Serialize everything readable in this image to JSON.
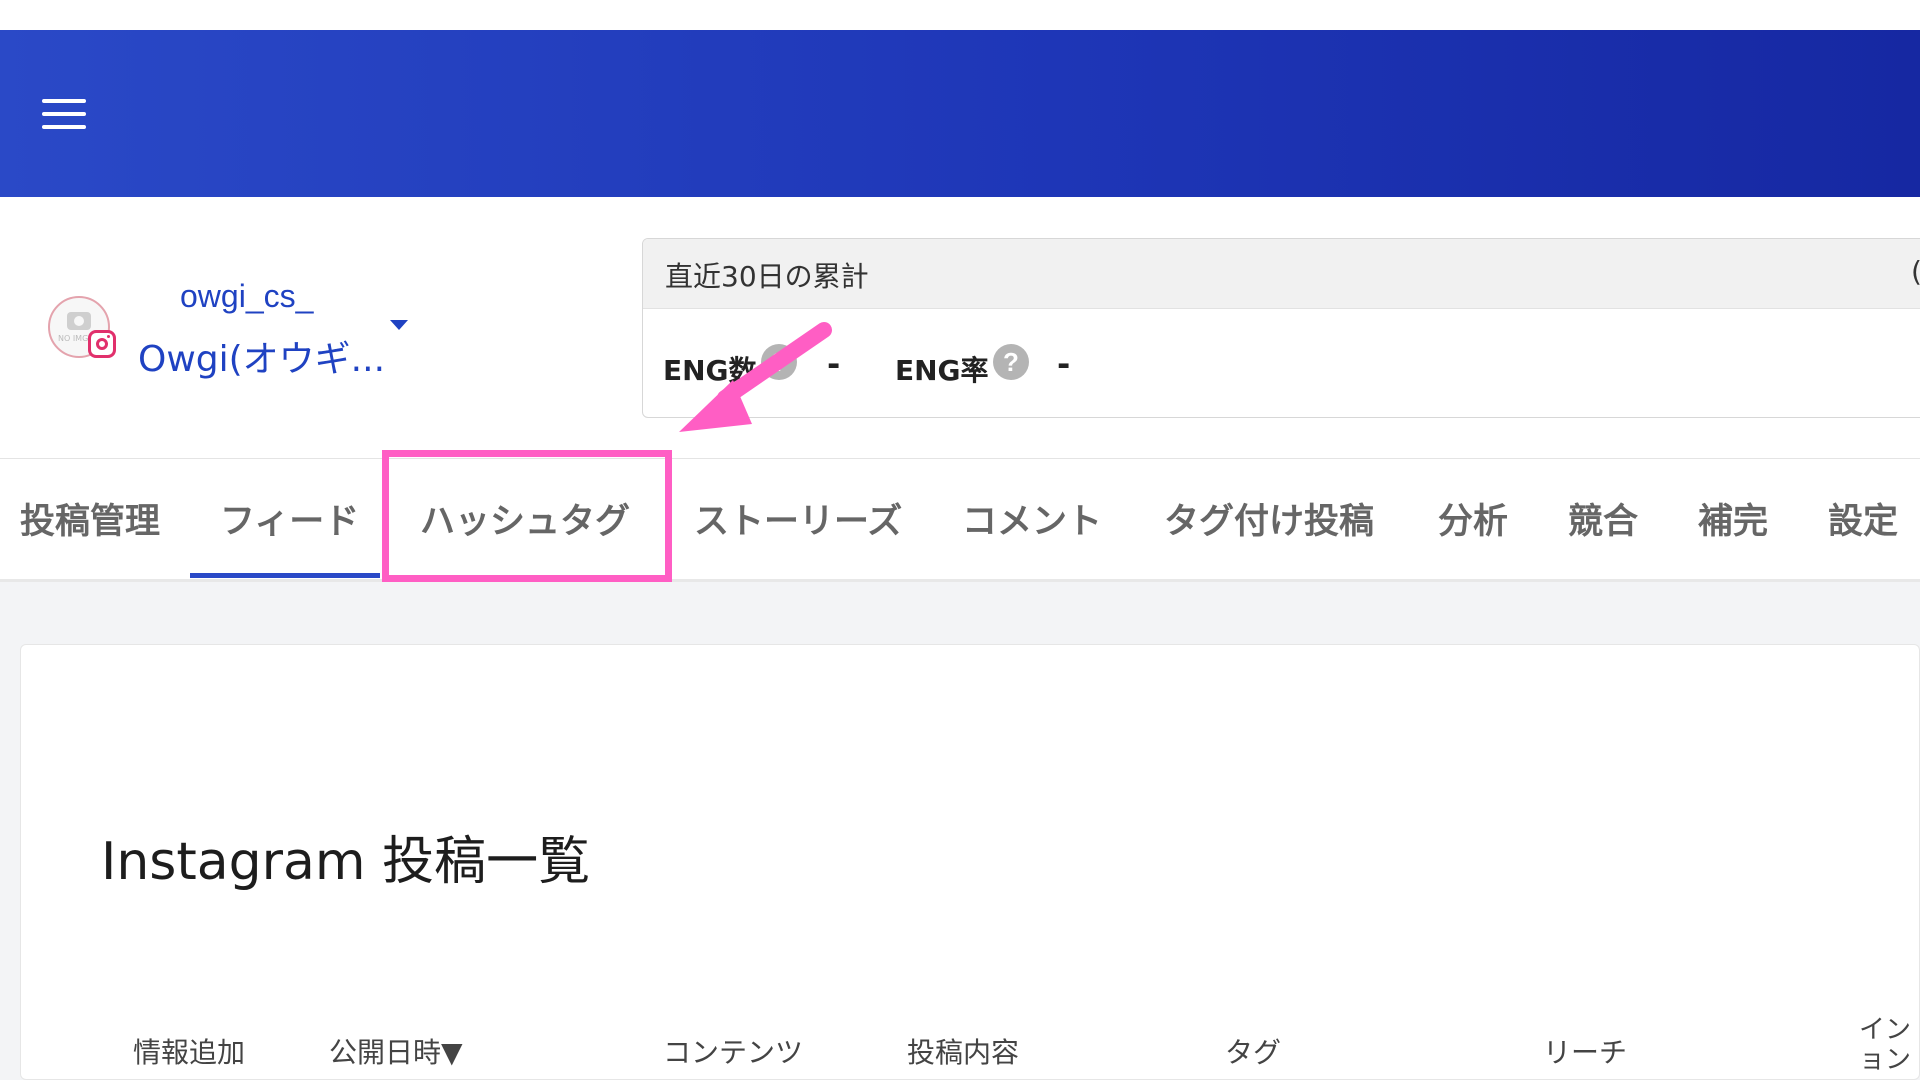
{
  "header": {
    "menu_icon": "hamburger-menu-icon"
  },
  "account": {
    "id": "owgi_cs_",
    "name": "Owgi(オウギ...",
    "avatar_placeholder": "NO IMG"
  },
  "summary": {
    "title": "直近30日の累計",
    "paren": "(",
    "metrics": [
      {
        "label": "ENG数",
        "help": "?",
        "value": "-"
      },
      {
        "label": "ENG率",
        "help": "?",
        "value": "-"
      }
    ]
  },
  "tabs": [
    {
      "label": "投稿管理"
    },
    {
      "label": "フィード",
      "active": true
    },
    {
      "label": "ハッシュタグ",
      "highlighted": true
    },
    {
      "label": "ストーリーズ"
    },
    {
      "label": "コメント"
    },
    {
      "label": "タグ付け投稿"
    },
    {
      "label": "分析"
    },
    {
      "label": "競合"
    },
    {
      "label": "補完"
    },
    {
      "label": "設定"
    }
  ],
  "list": {
    "title": "Instagram 投稿一覧",
    "columns": [
      "情報追加",
      "公開日時▼",
      "コンテンツ",
      "投稿内容",
      "タグ",
      "リーチ"
    ],
    "last_column": [
      "イン",
      "ョン"
    ]
  },
  "colors": {
    "header_start": "#2a49c7",
    "header_end": "#1628a2",
    "accent": "#2a49c7",
    "annotation": "#ff5ec4"
  }
}
